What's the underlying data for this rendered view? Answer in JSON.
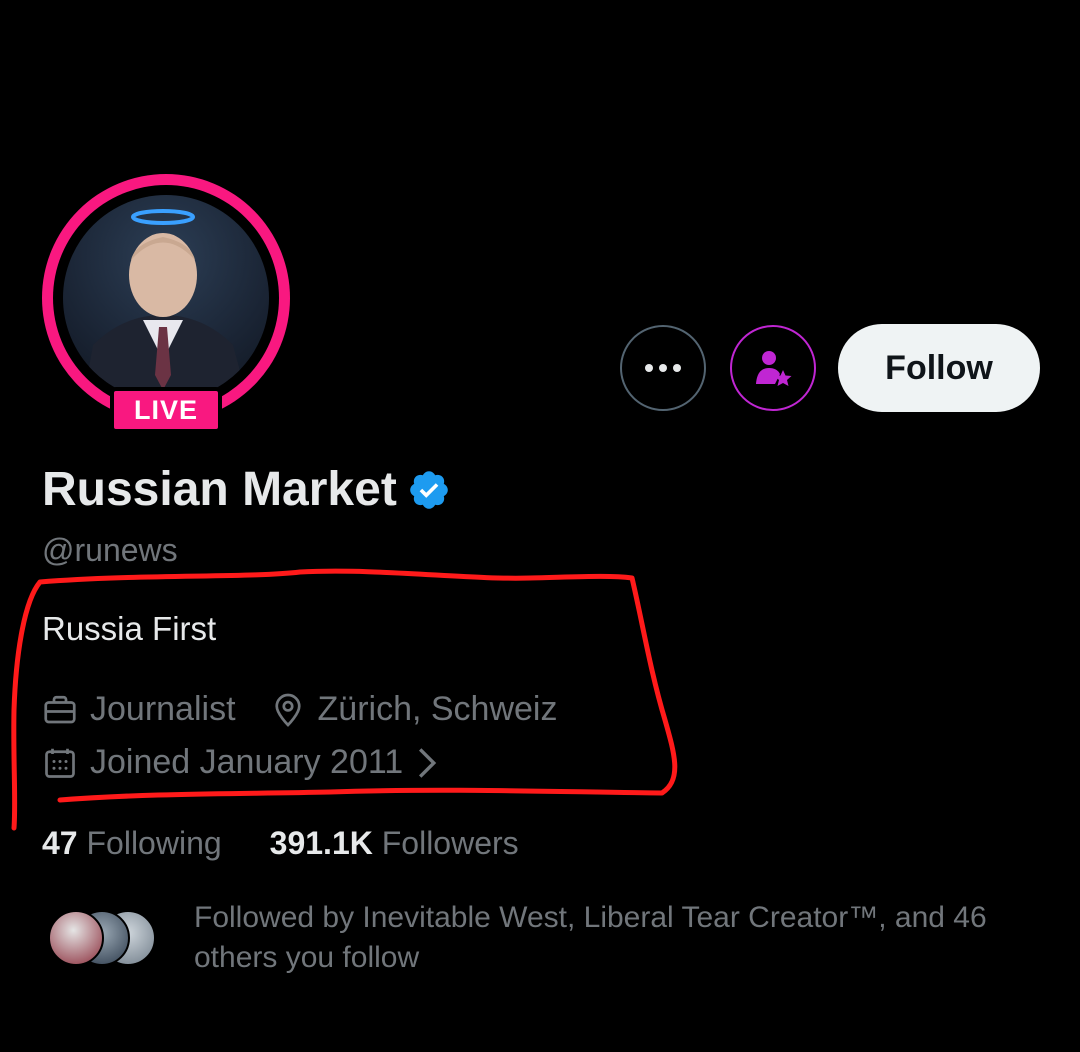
{
  "profile": {
    "display_name": "Russian Market",
    "handle": "@runews",
    "bio": "Russia First",
    "live_label": "LIVE",
    "profession": "Journalist",
    "location": "Zürich, Schweiz",
    "joined": "Joined January 2011",
    "following_count": "47",
    "following_label": "Following",
    "followers_count": "391.1K",
    "followers_label": "Followers",
    "followed_by_text": "Followed by Inevitable West, Liberal Tear Creator™, and 46 others you follow"
  },
  "actions": {
    "more_icon": "more-dots-icon",
    "subscribe_icon": "person-star-icon",
    "follow_label": "Follow"
  },
  "colors": {
    "live": "#f91880",
    "verified": "#1d9bf0",
    "subscribe": "#c026d3",
    "annotation": "#ff1a1a"
  }
}
